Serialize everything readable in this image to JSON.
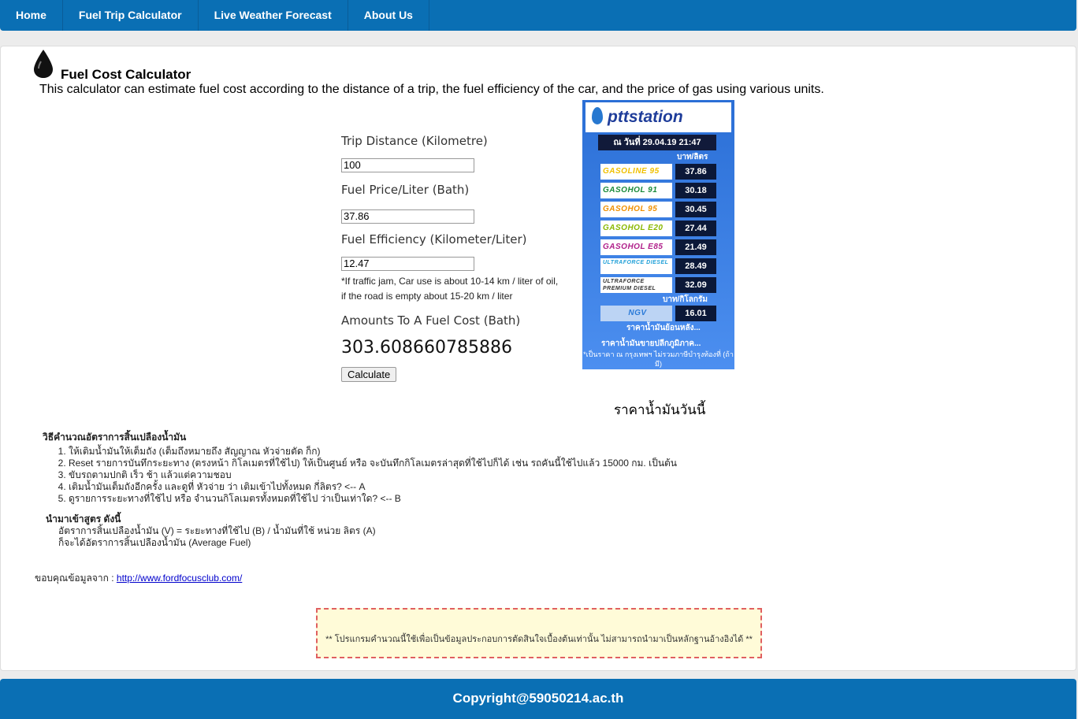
{
  "nav": {
    "items": [
      {
        "label": "Home"
      },
      {
        "label": "Fuel Trip Calculator"
      },
      {
        "label": "Live Weather Forecast"
      },
      {
        "label": "About Us"
      }
    ]
  },
  "header": {
    "title": "Fuel Cost Calculator",
    "description": "This calculator can estimate fuel cost according to the distance of a trip, the fuel efficiency of the car, and the price of gas using various units.",
    "icon": "oil-drop-icon"
  },
  "calculator": {
    "distance_label": "Trip Distance (Kilometre)",
    "distance_value": "100",
    "price_label": "Fuel Price/Liter (Bath)",
    "price_value": "37.86",
    "efficiency_label": "Fuel Efficiency (Kilometer/Liter)",
    "efficiency_value": "12.47",
    "note_line1": "*If traffic jam, Car use is about 10-14 km / liter of oil,",
    "note_line2": "if the road is empty about 15-20 km / liter",
    "result_label": "Amounts To A Fuel Cost (Bath)",
    "result_value": "303.608660785886",
    "button_label": "Calculate"
  },
  "ptt_widget": {
    "logo": "pttstation",
    "date": "ณ วันที่ 29.04.19 21:47",
    "unit_liter": "บาท/ลิตร",
    "unit_kg": "บาท/กิโลกรัม",
    "fuels": [
      {
        "name": "GASOLINE 95",
        "price": "37.86",
        "color": "#f0c000"
      },
      {
        "name": "GASOHOL 91",
        "price": "30.18",
        "color": "#1a8a3a"
      },
      {
        "name": "GASOHOL 95",
        "price": "30.45",
        "color": "#f09000"
      },
      {
        "name": "GASOHOL E20",
        "price": "27.44",
        "color": "#8ab800"
      },
      {
        "name": "GASOHOL E85",
        "price": "21.49",
        "color": "#b0208a"
      },
      {
        "name": "ULTRAFORCE DIESEL",
        "price": "28.49",
        "color": "#20a0d8"
      },
      {
        "name": "ULTRAFORCE PREMIUM DIESEL",
        "price": "32.09",
        "color": "#333333"
      }
    ],
    "ngv": {
      "name": "NGV",
      "price": "16.01"
    },
    "link_history": "ราคาน้ำมันย้อนหลัง...",
    "link_regional": "ราคาน้ำมันขายปลีกภูมิภาค...",
    "footnote": "*เป็นราคา ณ กรุงเทพฯ ไม่รวมภาษีบำรุงท้องที่ (ถ้ามี)"
  },
  "today_caption": "ราคาน้ำมันวันนี้",
  "howto": {
    "title": "วิธีคำนวณอัตราการสิ้นเปลืองน้ำมัน",
    "steps": [
      "ให้เติมน้ำมันให้เต็มถัง (เต็มถึงหมายถึง สัญญาณ หัวจ่ายตัด ก็ก)",
      "Reset รายการบันทึกระยะทาง (ตรงหน้า กิโลเมตรที่ใช้ไป) ให้เป็นศูนย์ หรือ จะบันทึกกิโลเมตรล่าสุดที่ใช้ไปก็ได้ เช่น รถคันนี้ใช้ไปแล้ว 15000 กม. เป็นต้น",
      "ขับรถตามปกติ เร็ว ช้า แล้วแต่ความชอบ",
      "เติมน้ำมันเต็มถังอีกครั้ง และดูที่ หัวจ่าย ว่า เติมเข้าไปทั้งหมด กี่ลิตร? <-- A",
      "ดูรายการระยะทางที่ใช้ไป หรือ จำนวนกิโลเมตรทั้งหมดที่ใช้ไป ว่าเป็นเท่าใด? <-- B"
    ]
  },
  "formula": {
    "title": "นำมาเข้าสูตร ดังนี้",
    "line1": "อัตราการสิ้นเปลืองน้ำมัน (V) = ระยะทางที่ใช้ไป (B) / น้ำมันที่ใช้ หน่วย ลิตร (A)",
    "line2": "ก็จะได้อัตราการสิ้นเปลืองน้ำมัน (Average Fuel)"
  },
  "thanks": {
    "label": "ขอบคุณข้อมูลจาก : ",
    "link": "http://www.fordfocusclub.com/"
  },
  "disclaimer": "** โปรแกรมคำนวณนี้ใช้เพื่อเป็นข้อมูลประกอบการตัดสินใจเบื้องต้นเท่านั้น ไม่สามารถนำมาเป็นหลักฐานอ้างอิงได้ **",
  "footer": {
    "text": "Copyright@59050214.ac.th"
  }
}
